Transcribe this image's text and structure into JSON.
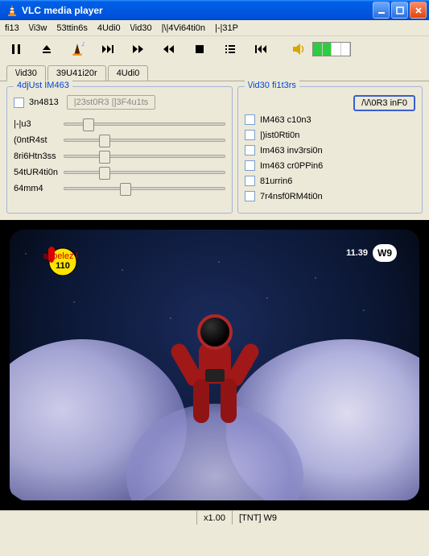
{
  "window": {
    "title": "VLC media player"
  },
  "menu": [
    "fi13",
    "\\/i3w",
    "53ttin6s",
    "4Udi0",
    "\\/id30",
    "|\\|4Vi64ti0n",
    "|-|31P"
  ],
  "tabs": [
    {
      "label": "\\/id30",
      "active": true
    },
    {
      "label": "39U41i20r",
      "active": false
    },
    {
      "label": "4Udi0",
      "active": false
    }
  ],
  "adjust": {
    "title": "4djUst IM463",
    "enable_label": "3n4813",
    "restore_label": "|23st0R3 |]3F4u1ts",
    "sliders": [
      {
        "label": "|-|u3",
        "pos": 15
      },
      {
        "label": "(0ntR4st",
        "pos": 25
      },
      {
        "label": "8ri6Htn3ss",
        "pos": 25
      },
      {
        "label": "54tUR4ti0n",
        "pos": 25
      },
      {
        "label": "64mm4",
        "pos": 38
      }
    ]
  },
  "filters": {
    "title": "\\/id30 fi1t3rs",
    "more_label": "/\\/\\0R3 inF0",
    "items": [
      "IM463 c10n3",
      "|)ist0Rti0n",
      "Im463 inv3rsi0n",
      "Im463 cr0PPin6",
      "81urrin6",
      "7r4nsf0RM4ti0n"
    ]
  },
  "overlay": {
    "badge_top": "appelez le",
    "badge_num": "110",
    "time": "11.39",
    "channel": "W9"
  },
  "status": {
    "speed": "x1.00",
    "channel": "[TNT] W9"
  }
}
